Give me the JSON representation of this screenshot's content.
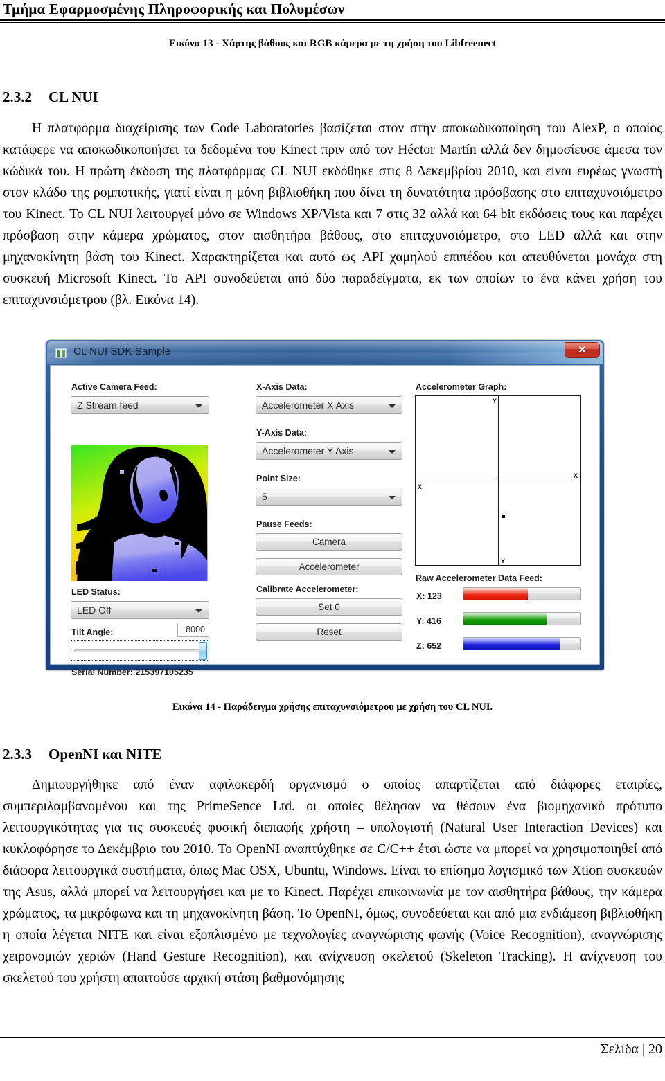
{
  "header": {
    "department": "Τμήμα Εφαρμοσμένης Πληροφορικής και Πολυμέσων"
  },
  "figure13": {
    "caption": "Εικόνα 13 - Χάρτης βάθους και RGB κάμερα  με τη χρήση του Libfreenect"
  },
  "section_232": {
    "number": "2.3.2",
    "title": "CL NUI",
    "paragraph": "Η πλατφόρμα διαχείρισης των Code Laboratories βασίζεται στον στην αποκωδικοποίηση του AlexP, ο οποίος κατάφερε να αποκωδικοποιήσει τα δεδομένα του Kinect πριν από τον Héctor Martín αλλά δεν δημοσίευσε άμεσα τον κώδικά του. Η πρώτη έκδοση της πλατφόρμας CL NUI εκδόθηκε στις 8 Δεκεμβρίου 2010, και είναι ευρέως γνωστή στον κλάδο της ρομποτικής, γιατί είναι η μόνη βιβλιοθήκη που δίνει τη δυνατότητα πρόσβασης στο επιταχυνσιόμετρο του Kinect. Το CL NUI λειτουργεί μόνο σε Windows XP/Vista και 7 στις 32 αλλά και 64 bit εκδόσεις τους και παρέχει πρόσβαση στην κάμερα χρώματος, στον αισθητήρα βάθους, στο επιταχυνσιόμετρο, στο LED αλλά και στην μηχανοκίνητη βάση του Kinect. Χαρακτηρίζεται και αυτό ως API χαμηλού επιπέδου και απευθύνεται μονάχα στη συσκευή Microsoft Kinect. Το API συνοδεύεται από δύο παραδείγματα, εκ των οποίων το ένα κάνει χρήση του επιταχυνσιόμετρου (βλ. Εικόνα 14)."
  },
  "app": {
    "title": "CL NUI SDK Sample",
    "close_label": "✕",
    "labels": {
      "active_camera_feed": "Active Camera Feed:",
      "led_status": "LED Status:",
      "tilt_angle": "Tilt Angle:",
      "serial_number": "Serial Number: 215397105235",
      "x_axis_data": "X-Axis Data:",
      "y_axis_data": "Y-Axis Data:",
      "point_size": "Point Size:",
      "pause_feeds": "Pause Feeds:",
      "calibrate_accelerometer": "Calibrate Accelerometer:",
      "accelerometer_graph": "Accelerometer Graph:",
      "raw_accelerometer_data_feed": "Raw Accelerometer Data Feed:"
    },
    "combos": {
      "camera_feed": "Z Stream feed",
      "led_status": "LED Off",
      "x_axis": "Accelerometer X Axis",
      "y_axis": "Accelerometer Y Axis",
      "point_size": "5"
    },
    "buttons": {
      "camera": "Camera",
      "accelerometer": "Accelerometer",
      "set_zero": "Set 0",
      "reset": "Reset"
    },
    "tilt": {
      "value": "8000"
    },
    "graph": {
      "axis_top": "Y",
      "axis_right": "X",
      "axis_left": "X",
      "axis_bottom": "Y",
      "point_x_pct": 52,
      "point_y_pct": 70
    },
    "raw_feed": [
      {
        "label": "X: 123",
        "pct": 55,
        "color": "red"
      },
      {
        "label": "Y: 416",
        "pct": 71,
        "color": "green"
      },
      {
        "label": "Z: 652",
        "pct": 82,
        "color": "blue"
      }
    ]
  },
  "figure14": {
    "caption": "Εικόνα 14 - Παράδειγμα χρήσης επιταχυνσιόμετρου με χρήση του CL NUI."
  },
  "section_233": {
    "number": "2.3.3",
    "title": "OpenNI και NITE",
    "paragraph": "Δημιουργήθηκε από έναν αφιλοκερδή οργανισμό ο οποίος απαρτίζεται από διάφορες εταιρίες, συμπεριλαμβανομένου και της PrimeSence Ltd. οι οποίες θέλησαν να θέσουν ένα βιομηχανικό πρότυπο λειτουργικότητας για τις συσκευές φυσική διεπαφής χρήστη – υπολογιστή (Natural User Interaction Devices) και κυκλοφόρησε το Δεκέμβριο του 2010. Το OpenNI αναπτύχθηκε σε C/C++ έτσι ώστε να μπορεί να χρησιμοποιηθεί από διάφορα λειτουργικά συστήματα, όπως Mac OSX, Ubuntu, Windows. Είναι το επίσημο λογισμικό των Xtion συσκευών της Asus, αλλά μπορεί να λειτουργήσει και με το Kinect. Παρέχει επικοινωνία με τον αισθητήρα βάθους, την κάμερα χρώματος, τα μικρόφωνα και τη μηχανοκίνητη βάση. Το OpenNI, όμως, συνοδεύεται και από μια ενδιάμεση βιβλιοθήκη η οποία λέγεται NITE και είναι εξοπλισμένο με τεχνολογίες αναγνώρισης φωνής (Voice Recognition), αναγνώρισης χειρονομιών χεριών (Hand Gesture Recognition), και ανίχνευση σκελετού (Skeleton Tracking). Η ανίχνευση του σκελετού του χρήστη απαιτούσε αρχική στάση βαθμονόμησης"
  },
  "footer": {
    "page_label": "Σελίδα | 20"
  }
}
